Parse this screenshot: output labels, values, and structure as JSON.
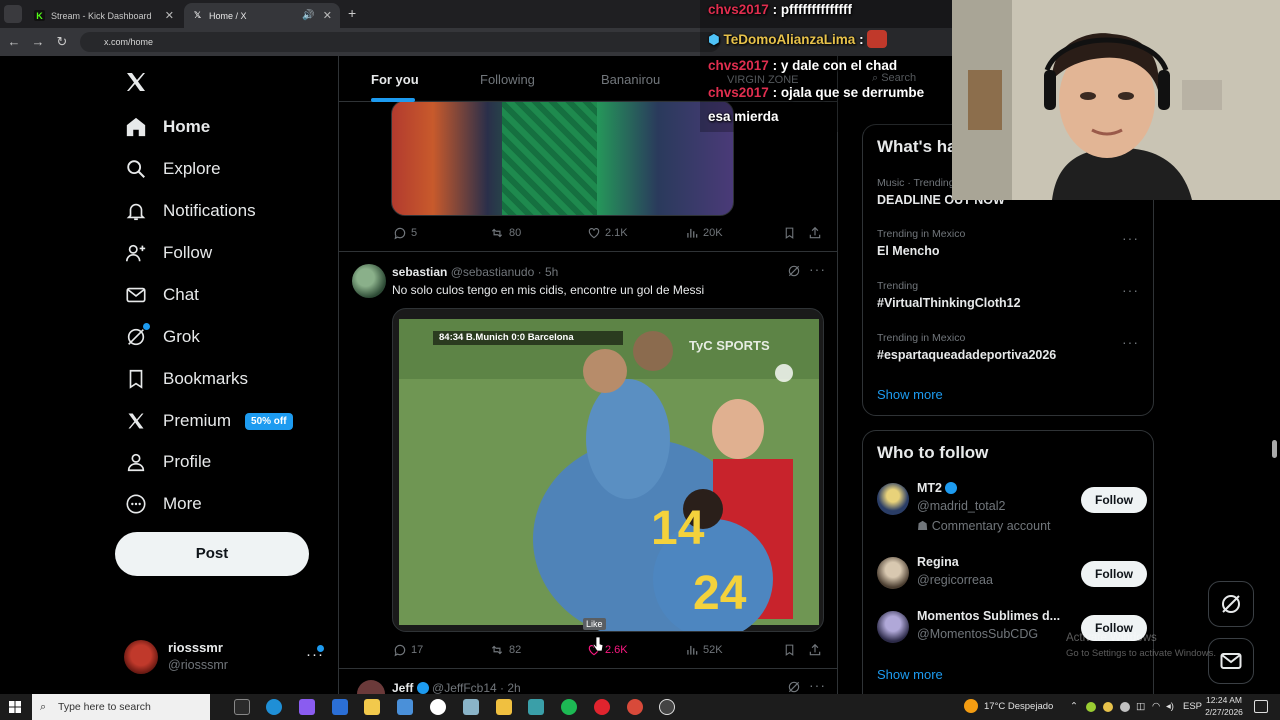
{
  "browser": {
    "tabs": [
      {
        "title": "Stream - Kick Dashboard",
        "active": false,
        "favicon": "kick-icon",
        "color": "#53fc18"
      },
      {
        "title": "Home / X",
        "active": true,
        "favicon": "x-logo-icon"
      }
    ],
    "url": "x.com/home"
  },
  "sidebar": {
    "items": [
      {
        "label": "Home",
        "icon": "home-icon",
        "active": true
      },
      {
        "label": "Explore",
        "icon": "search-icon"
      },
      {
        "label": "Notifications",
        "icon": "bell-icon"
      },
      {
        "label": "Follow",
        "icon": "person-plus-icon"
      },
      {
        "label": "Chat",
        "icon": "mail-icon"
      },
      {
        "label": "Grok",
        "icon": "grok-icon"
      },
      {
        "label": "Bookmarks",
        "icon": "bookmark-icon"
      },
      {
        "label": "Premium",
        "icon": "x-logo-icon",
        "badge": "50% off"
      },
      {
        "label": "Profile",
        "icon": "person-icon"
      },
      {
        "label": "More",
        "icon": "more-circle-icon"
      }
    ],
    "post_label": "Post",
    "account": {
      "name": "riosssmr",
      "handle": "@riosssmr"
    }
  },
  "feed": {
    "tabs": [
      "For you",
      "Following",
      "Bananirou",
      "VIRGIN ZONE"
    ],
    "tweets": [
      {
        "replies": "5",
        "reposts": "80",
        "likes": "2.1K",
        "views": "20K"
      },
      {
        "name": "sebastian",
        "handle": "@sebastianudo",
        "time": "· 5h",
        "text": "No solo culos tengo en mis cidis, encontre un gol de Messi",
        "video_overlay": {
          "scoreboard": "84:34 B.Munich 0:0 Barcelona",
          "channel": "TyC SPORTS"
        },
        "replies": "17",
        "reposts": "82",
        "likes": "2.6K",
        "views": "52K",
        "tooltip": "Like"
      },
      {
        "name": "Jeff",
        "handle": "@JeffFcb14",
        "time": "· 2h"
      }
    ]
  },
  "right": {
    "search_placeholder": "Search",
    "trends_title": "What's happening",
    "trends": [
      {
        "context": "Music · Trending",
        "name": "DEADLINE OUT NOW"
      },
      {
        "context": "Trending in Mexico",
        "name": "El Mencho"
      },
      {
        "context": "Trending",
        "name": "#VirtualThinkingCloth12"
      },
      {
        "context": "Trending in Mexico",
        "name": "#espartaqueadadeportiva2026"
      }
    ],
    "trends_show_more": "Show more",
    "wtf_title": "Who to follow",
    "who_to_follow": [
      {
        "name": "MT2",
        "handle": "@madrid_total2",
        "subtitle": "Commentary account",
        "verified": true
      },
      {
        "name": "Regina",
        "handle": "@regicorreaa"
      },
      {
        "name": "Momentos Sublimes d...",
        "handle": "@MomentosSubCDG"
      }
    ],
    "follow_label": "Follow",
    "wtf_show_more": "Show more"
  },
  "stream_chat": [
    {
      "user": "chvs2017",
      "sep": " : ",
      "msg": "pffffffffffffff"
    },
    {
      "user": "TeDomoAlianzaLima",
      "sep": " : ",
      "msg": ""
    },
    {
      "user": "chvs2017",
      "sep": " : ",
      "msg": "y dale con el chad"
    },
    {
      "user": "chvs2017",
      "sep": " : ",
      "msg": "ojala que se derrumbe"
    },
    {
      "user": "",
      "sep": "",
      "msg": "esa mierda"
    }
  ],
  "watermark": {
    "line1": "Activate Windows",
    "line2": "Go to Settings to activate Windows."
  },
  "taskbar": {
    "search_placeholder": "Type here to search",
    "weather": "17°C  Despejado",
    "lang": "ESP",
    "time": "12:24 AM",
    "date": "2/27/2026"
  },
  "colors": {
    "accent": "#1d9bf0",
    "background": "#000000",
    "border": "#2f3336",
    "muted": "#71767b"
  }
}
